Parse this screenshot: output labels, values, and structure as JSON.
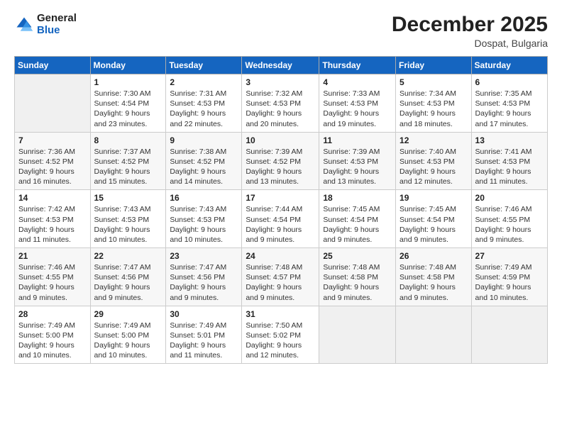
{
  "logo": {
    "general": "General",
    "blue": "Blue"
  },
  "header": {
    "month": "December 2025",
    "location": "Dospat, Bulgaria"
  },
  "weekdays": [
    "Sunday",
    "Monday",
    "Tuesday",
    "Wednesday",
    "Thursday",
    "Friday",
    "Saturday"
  ],
  "weeks": [
    [
      {
        "day": "",
        "info": ""
      },
      {
        "day": "1",
        "info": "Sunrise: 7:30 AM\nSunset: 4:54 PM\nDaylight: 9 hours\nand 23 minutes."
      },
      {
        "day": "2",
        "info": "Sunrise: 7:31 AM\nSunset: 4:53 PM\nDaylight: 9 hours\nand 22 minutes."
      },
      {
        "day": "3",
        "info": "Sunrise: 7:32 AM\nSunset: 4:53 PM\nDaylight: 9 hours\nand 20 minutes."
      },
      {
        "day": "4",
        "info": "Sunrise: 7:33 AM\nSunset: 4:53 PM\nDaylight: 9 hours\nand 19 minutes."
      },
      {
        "day": "5",
        "info": "Sunrise: 7:34 AM\nSunset: 4:53 PM\nDaylight: 9 hours\nand 18 minutes."
      },
      {
        "day": "6",
        "info": "Sunrise: 7:35 AM\nSunset: 4:53 PM\nDaylight: 9 hours\nand 17 minutes."
      }
    ],
    [
      {
        "day": "7",
        "info": "Sunrise: 7:36 AM\nSunset: 4:52 PM\nDaylight: 9 hours\nand 16 minutes."
      },
      {
        "day": "8",
        "info": "Sunrise: 7:37 AM\nSunset: 4:52 PM\nDaylight: 9 hours\nand 15 minutes."
      },
      {
        "day": "9",
        "info": "Sunrise: 7:38 AM\nSunset: 4:52 PM\nDaylight: 9 hours\nand 14 minutes."
      },
      {
        "day": "10",
        "info": "Sunrise: 7:39 AM\nSunset: 4:52 PM\nDaylight: 9 hours\nand 13 minutes."
      },
      {
        "day": "11",
        "info": "Sunrise: 7:39 AM\nSunset: 4:53 PM\nDaylight: 9 hours\nand 13 minutes."
      },
      {
        "day": "12",
        "info": "Sunrise: 7:40 AM\nSunset: 4:53 PM\nDaylight: 9 hours\nand 12 minutes."
      },
      {
        "day": "13",
        "info": "Sunrise: 7:41 AM\nSunset: 4:53 PM\nDaylight: 9 hours\nand 11 minutes."
      }
    ],
    [
      {
        "day": "14",
        "info": "Sunrise: 7:42 AM\nSunset: 4:53 PM\nDaylight: 9 hours\nand 11 minutes."
      },
      {
        "day": "15",
        "info": "Sunrise: 7:43 AM\nSunset: 4:53 PM\nDaylight: 9 hours\nand 10 minutes."
      },
      {
        "day": "16",
        "info": "Sunrise: 7:43 AM\nSunset: 4:53 PM\nDaylight: 9 hours\nand 10 minutes."
      },
      {
        "day": "17",
        "info": "Sunrise: 7:44 AM\nSunset: 4:54 PM\nDaylight: 9 hours\nand 9 minutes."
      },
      {
        "day": "18",
        "info": "Sunrise: 7:45 AM\nSunset: 4:54 PM\nDaylight: 9 hours\nand 9 minutes."
      },
      {
        "day": "19",
        "info": "Sunrise: 7:45 AM\nSunset: 4:54 PM\nDaylight: 9 hours\nand 9 minutes."
      },
      {
        "day": "20",
        "info": "Sunrise: 7:46 AM\nSunset: 4:55 PM\nDaylight: 9 hours\nand 9 minutes."
      }
    ],
    [
      {
        "day": "21",
        "info": "Sunrise: 7:46 AM\nSunset: 4:55 PM\nDaylight: 9 hours\nand 9 minutes."
      },
      {
        "day": "22",
        "info": "Sunrise: 7:47 AM\nSunset: 4:56 PM\nDaylight: 9 hours\nand 9 minutes."
      },
      {
        "day": "23",
        "info": "Sunrise: 7:47 AM\nSunset: 4:56 PM\nDaylight: 9 hours\nand 9 minutes."
      },
      {
        "day": "24",
        "info": "Sunrise: 7:48 AM\nSunset: 4:57 PM\nDaylight: 9 hours\nand 9 minutes."
      },
      {
        "day": "25",
        "info": "Sunrise: 7:48 AM\nSunset: 4:58 PM\nDaylight: 9 hours\nand 9 minutes."
      },
      {
        "day": "26",
        "info": "Sunrise: 7:48 AM\nSunset: 4:58 PM\nDaylight: 9 hours\nand 9 minutes."
      },
      {
        "day": "27",
        "info": "Sunrise: 7:49 AM\nSunset: 4:59 PM\nDaylight: 9 hours\nand 10 minutes."
      }
    ],
    [
      {
        "day": "28",
        "info": "Sunrise: 7:49 AM\nSunset: 5:00 PM\nDaylight: 9 hours\nand 10 minutes."
      },
      {
        "day": "29",
        "info": "Sunrise: 7:49 AM\nSunset: 5:00 PM\nDaylight: 9 hours\nand 10 minutes."
      },
      {
        "day": "30",
        "info": "Sunrise: 7:49 AM\nSunset: 5:01 PM\nDaylight: 9 hours\nand 11 minutes."
      },
      {
        "day": "31",
        "info": "Sunrise: 7:50 AM\nSunset: 5:02 PM\nDaylight: 9 hours\nand 12 minutes."
      },
      {
        "day": "",
        "info": ""
      },
      {
        "day": "",
        "info": ""
      },
      {
        "day": "",
        "info": ""
      }
    ]
  ]
}
